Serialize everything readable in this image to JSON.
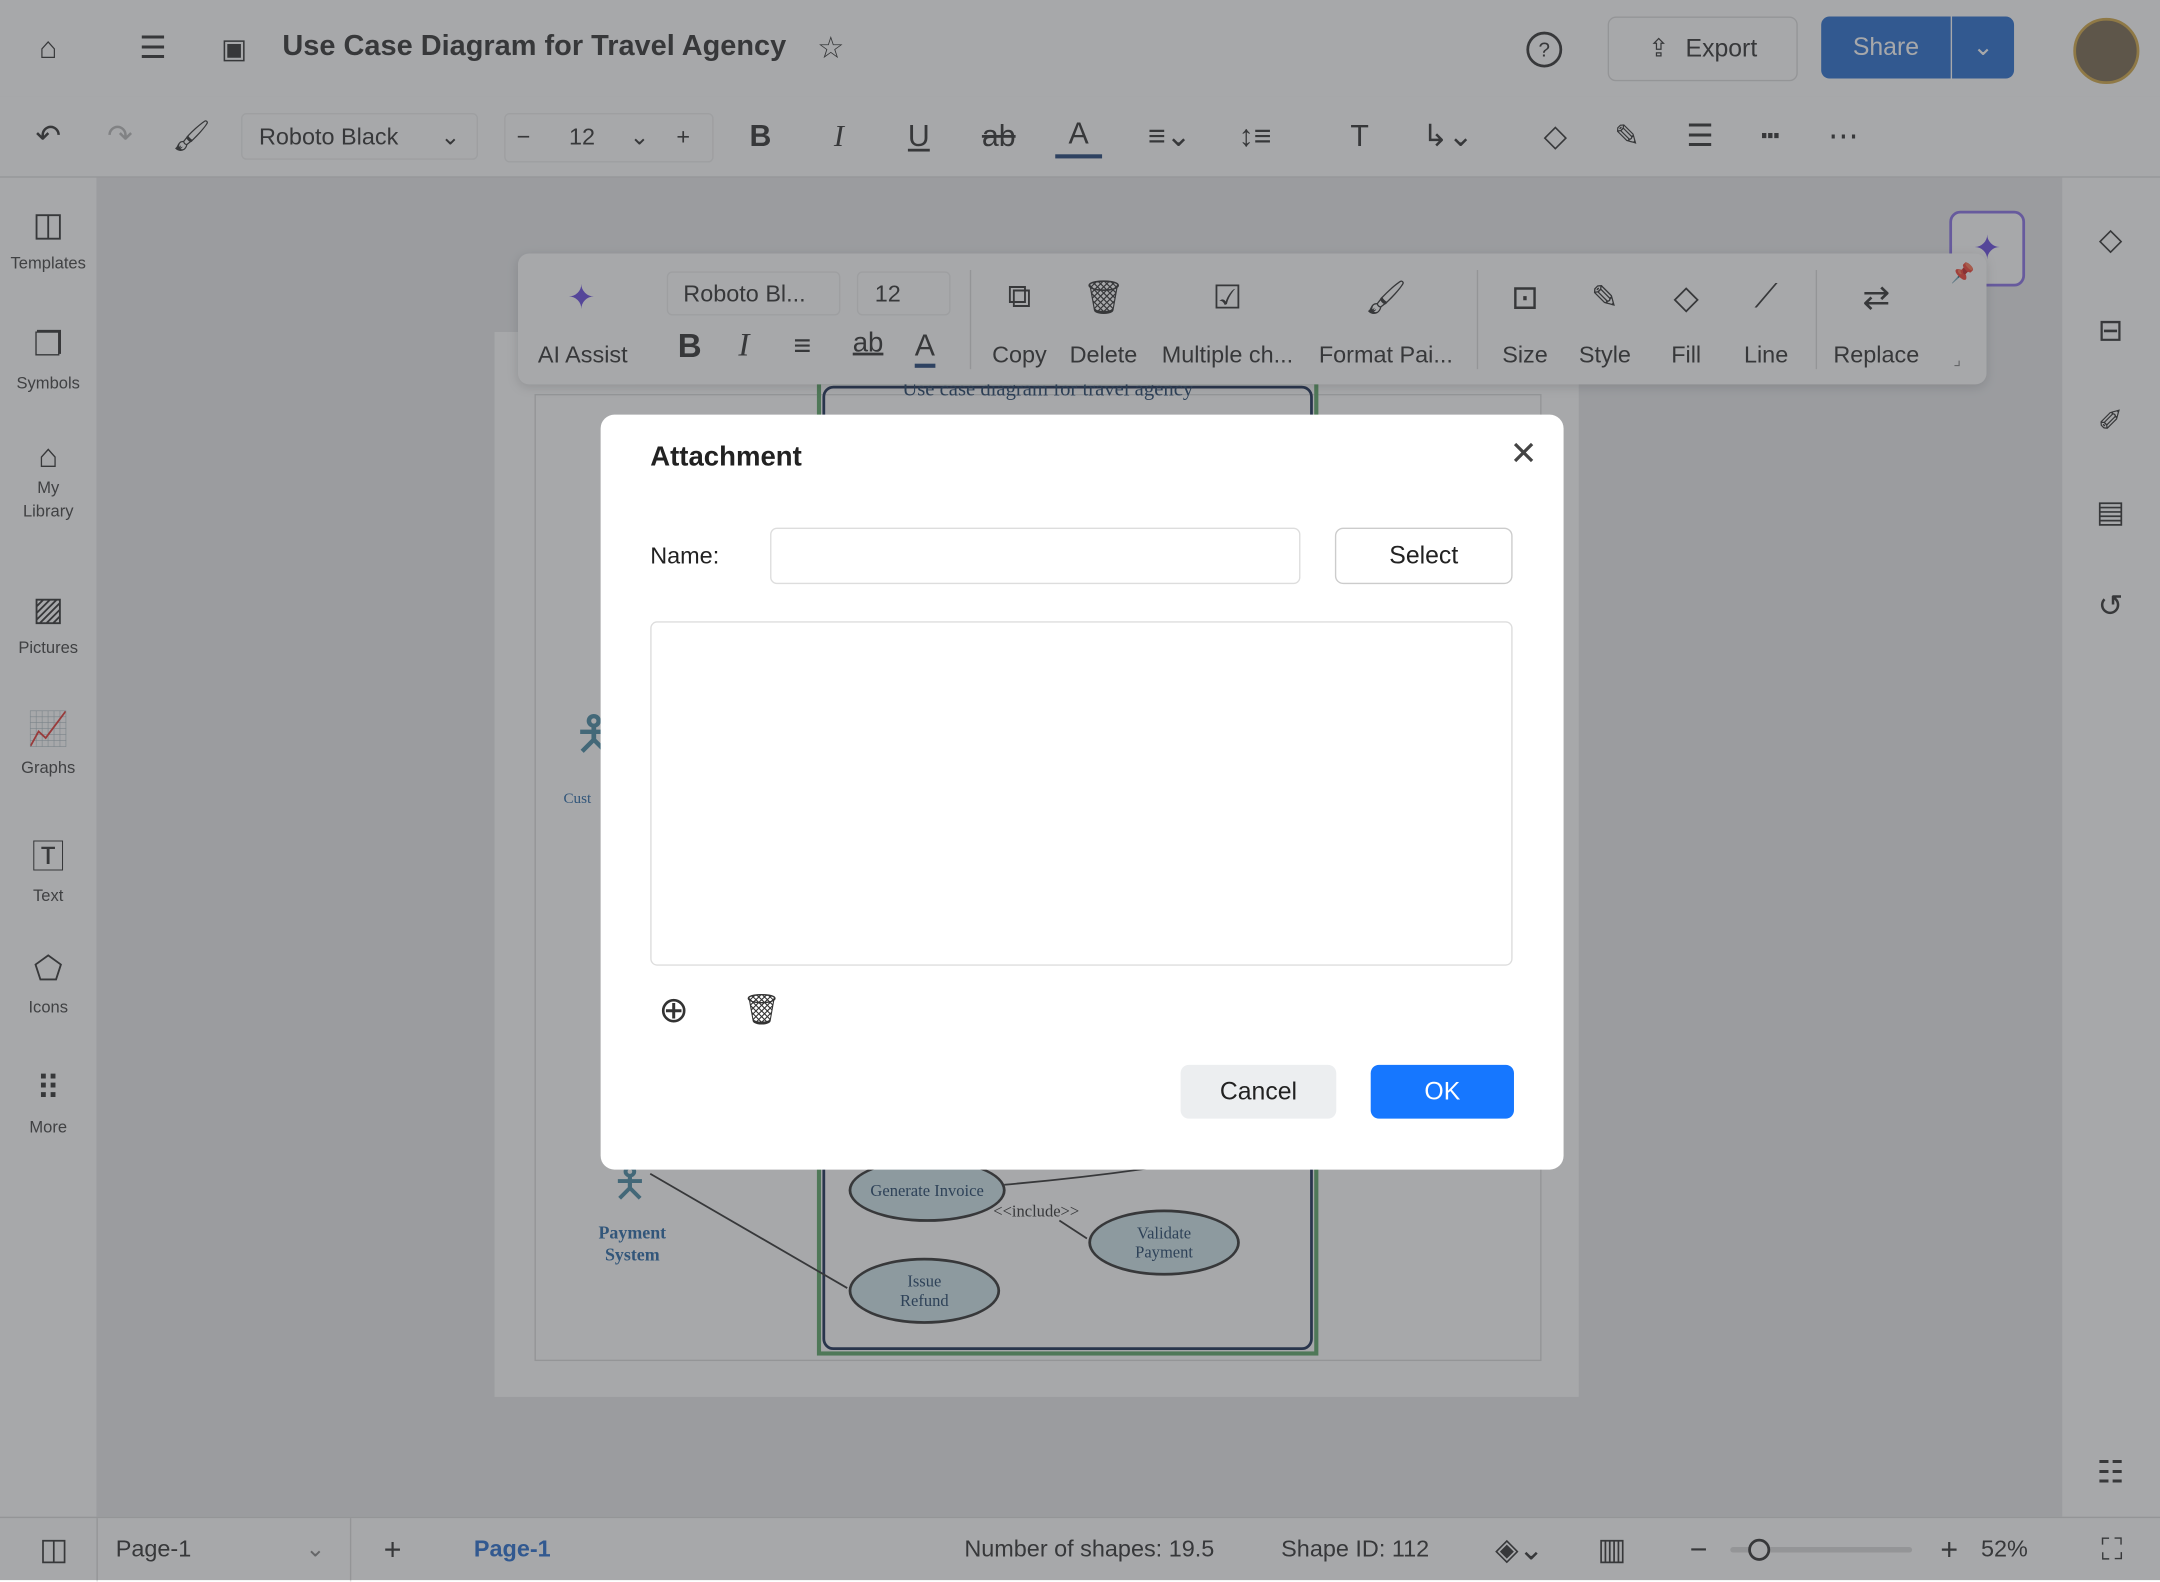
{
  "header": {
    "title": "Use Case Diagram for Travel Agency",
    "export_label": "Export",
    "share_label": "Share"
  },
  "format_toolbar": {
    "font": "Roboto Black",
    "size": "12"
  },
  "left_sidebar": {
    "items": [
      {
        "label": "Templates"
      },
      {
        "label": "Symbols"
      },
      {
        "label": "My Library"
      },
      {
        "label": "Pictures"
      },
      {
        "label": "Graphs"
      },
      {
        "label": "Text"
      },
      {
        "label": "Icons"
      },
      {
        "label": "More"
      }
    ]
  },
  "floating_toolbar": {
    "ai_assist": "AI Assist",
    "font": "Roboto Bl...",
    "size": "12",
    "copy": "Copy",
    "delete": "Delete",
    "multiple": "Multiple ch...",
    "format_painter": "Format Pai...",
    "size_label": "Size",
    "style": "Style",
    "fill": "Fill",
    "line": "Line",
    "replace": "Replace"
  },
  "diagram": {
    "title": "Use case diagram for travel agency",
    "actors": [
      "Cust",
      "Payment System"
    ],
    "use_cases": [
      "Generate Invoice",
      "Validate Payment",
      "Issue Refund"
    ],
    "relation": "<<include>>"
  },
  "dialog": {
    "title": "Attachment",
    "name_label": "Name:",
    "name_value": "",
    "select_label": "Select",
    "cancel_label": "Cancel",
    "ok_label": "OK"
  },
  "status_bar": {
    "page_select": "Page-1",
    "page_tab": "Page-1",
    "shape_count": "Number of shapes: 19.5",
    "shape_id": "Shape ID: 112",
    "zoom": "52%",
    "zoom_value": 52
  },
  "colors": {
    "accent": "#1677ff",
    "share": "#2a6fd0",
    "ai": "#6a4de0"
  }
}
